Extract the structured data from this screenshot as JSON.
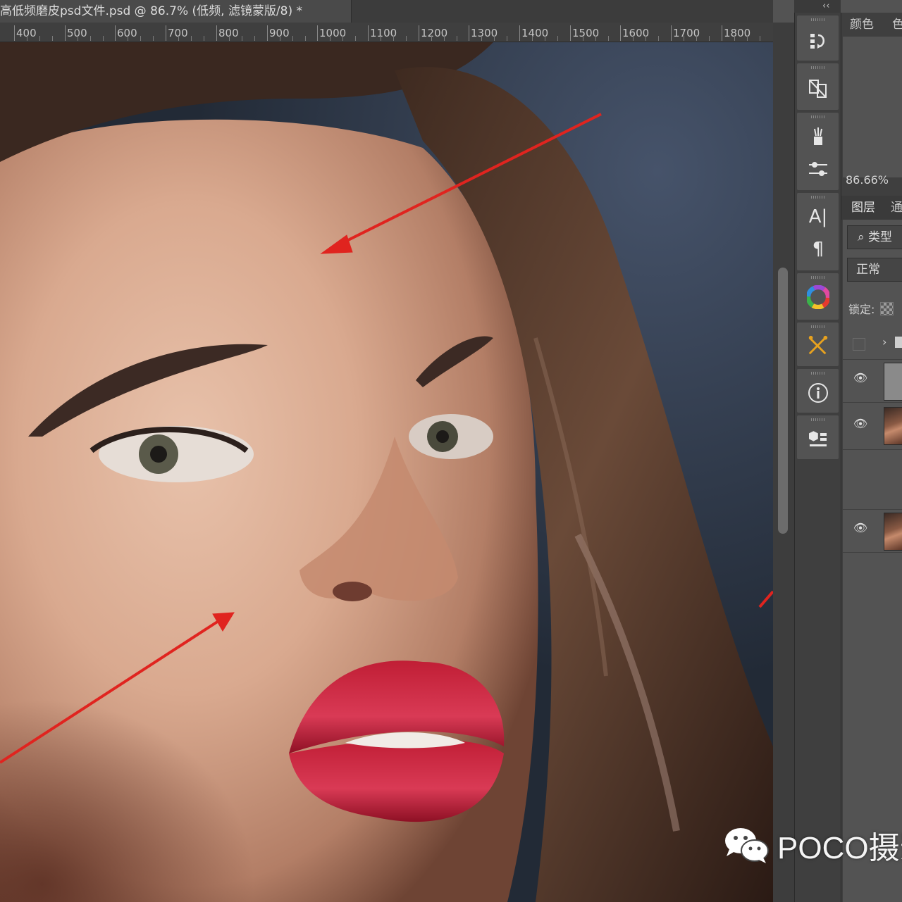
{
  "document": {
    "tab_title": "高低频磨皮psd文件.psd @ 86.7% (低频, 滤镜蒙版/8) *"
  },
  "ruler": {
    "labels": [
      "400",
      "500",
      "600",
      "700",
      "800",
      "900",
      "1000",
      "1100",
      "1200",
      "1300",
      "1400",
      "1500",
      "1600",
      "1700",
      "1800"
    ]
  },
  "panels": {
    "color_tab": "颜色",
    "swatch_tab_partial": "色",
    "zoom_value": "86.66%",
    "layers_tab": "图层",
    "channels_tab_partial": "通",
    "filter_label": "类型",
    "blend_mode": "正常",
    "lock_label": "锁定:"
  },
  "dock": {
    "collapse_glyph": "‹‹",
    "icons": [
      "history-icon",
      "properties-icon",
      "brush-icon",
      "brush-settings-icon",
      "character-icon",
      "paragraph-icon",
      "color-wheel-icon",
      "tool-presets-icon",
      "info-icon",
      "3d-icon"
    ]
  },
  "watermark": {
    "text": "POCO摄影"
  },
  "annotations": {
    "arrow_color": "#e0241f"
  }
}
